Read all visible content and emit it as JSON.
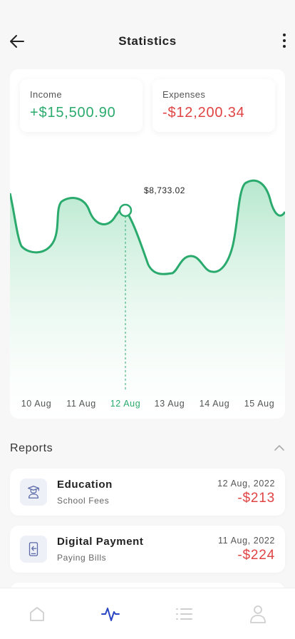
{
  "header": {
    "title": "Statistics"
  },
  "summary": {
    "income": {
      "label": "Income",
      "value": "+$15,500.90"
    },
    "expenses": {
      "label": "Expenses",
      "value": "-$12,200.34"
    }
  },
  "chart_data": {
    "type": "area",
    "categories": [
      "10 Aug",
      "11 Aug",
      "12 Aug",
      "13 Aug",
      "14 Aug",
      "15 Aug"
    ],
    "highlighted_category": "12 Aug",
    "tooltip": "$8,733.02",
    "y_axis_shown": false,
    "grid": false,
    "colors": {
      "line": "#2aaa6d",
      "fill": "#9ee0bd",
      "active_label": "#2aaa6d"
    }
  },
  "reports": {
    "title": "Reports",
    "items": [
      {
        "name": "Education",
        "subtitle": "School Fees",
        "date": "12 Aug, 2022",
        "amount": "-$213",
        "icon": "graduate-icon"
      },
      {
        "name": "Digital Payment",
        "subtitle": "Paying Bills",
        "date": "11 Aug, 2022",
        "amount": "-$224",
        "icon": "mobile-payment-icon"
      }
    ]
  },
  "nav": {
    "items": [
      {
        "name": "home",
        "icon": "home-icon",
        "active": false
      },
      {
        "name": "statistics",
        "icon": "activity-icon",
        "active": true
      },
      {
        "name": "list",
        "icon": "list-icon",
        "active": false
      },
      {
        "name": "profile",
        "icon": "user-icon",
        "active": false
      }
    ],
    "active_color": "#2845c4",
    "inactive_color": "#cfcfcf"
  }
}
